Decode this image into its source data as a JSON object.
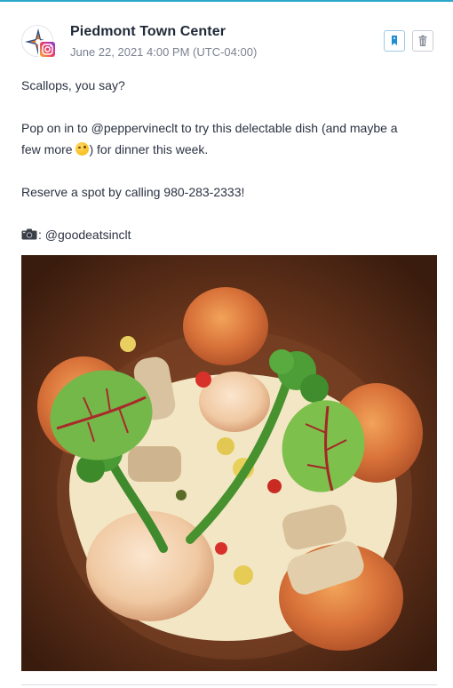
{
  "post": {
    "account_name": "Piedmont Town Center",
    "timestamp": "June 22, 2021 4:00 PM (UTC-04:00)",
    "platform": "instagram",
    "line_1": "Scallops, you say?",
    "line_2a": "Pop on in to @peppervineclt to try this delectable dish (and maybe a",
    "line_2b_before": "few more ",
    "line_2b_after": ") for dinner this week.",
    "line_3": "Reserve a spot by calling 980-283-2333!",
    "line_4": ": @goodeatsinclt",
    "image_alt": "Seared scallops with broccolini, mushrooms and red-vein sorrel on a brown plate"
  },
  "actions": {
    "tag_icon": "tag-icon",
    "delete_icon": "trash-icon"
  },
  "colors": {
    "accent_blue": "#2aa7c9",
    "tag_blue": "#1f8fd4",
    "text": "#2b3242",
    "muted": "#7a8190"
  }
}
